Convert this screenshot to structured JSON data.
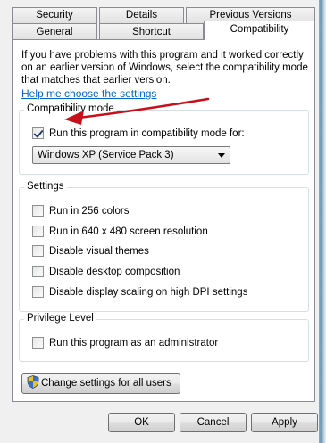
{
  "tabs": {
    "row1": [
      {
        "label": "Security",
        "active": false
      },
      {
        "label": "Details",
        "active": false
      },
      {
        "label": "Previous Versions",
        "active": false
      }
    ],
    "row2": [
      {
        "label": "General",
        "active": false
      },
      {
        "label": "Shortcut",
        "active": false
      },
      {
        "label": "Compatibility",
        "active": true
      }
    ]
  },
  "intro_text": "If you have problems with this program and it worked correctly on an earlier version of Windows, select the compatibility mode that matches that earlier version.",
  "help_link": "Help me choose the settings",
  "compat_mode": {
    "group_label": "Compatibility mode",
    "checkbox_label": "Run this program in compatibility mode for:",
    "checked": true,
    "selected_os": "Windows XP (Service Pack 3)"
  },
  "settings": {
    "group_label": "Settings",
    "items": [
      {
        "label": "Run in 256 colors",
        "checked": false
      },
      {
        "label": "Run in 640 x 480 screen resolution",
        "checked": false
      },
      {
        "label": "Disable visual themes",
        "checked": false
      },
      {
        "label": "Disable desktop composition",
        "checked": false
      },
      {
        "label": "Disable display scaling on high DPI settings",
        "checked": false
      }
    ]
  },
  "privilege": {
    "group_label": "Privilege Level",
    "checkbox_label": "Run this program as an administrator",
    "checked": false
  },
  "change_settings_button": "Change settings for all users",
  "buttons": {
    "ok": "OK",
    "cancel": "Cancel",
    "apply": "Apply"
  },
  "colors": {
    "link": "#0066cc",
    "annotation_arrow": "#c8101a",
    "group_border": "#d5dfe5"
  },
  "icons": {
    "uac": "uac-shield-icon",
    "dropdown": "chevron-down-icon",
    "annotation": "red-arrow-annotation"
  }
}
